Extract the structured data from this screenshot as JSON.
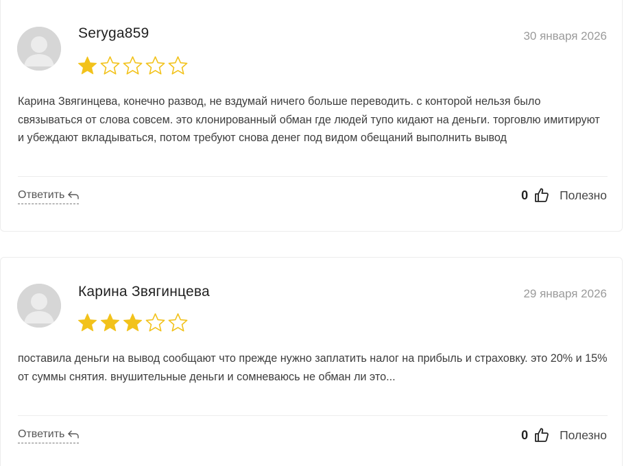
{
  "reviews": [
    {
      "author": "Seryga859",
      "date": "30 января 2026",
      "rating": 1,
      "max_rating": 5,
      "text": "Карина Звягинцева, конечно развод, не вздумай ничего больше переводить. с конторой нельзя было связываться от слова совсем. это клонированный обман где людей тупо кидают на деньги. торговлю имитируют и убеждают вкладываться, потом требуют снова денег под видом обещаний выполнить вывод",
      "reply_label": "Ответить",
      "helpful_count": "0",
      "helpful_label": "Полезно"
    },
    {
      "author": "Карина Звягинцева",
      "date": "29 января 2026",
      "rating": 3,
      "max_rating": 5,
      "text": "поставила деньги на вывод сообщают что прежде нужно заплатить налог на прибыль и страховку. это 20% и 15% от суммы снятия. внушительные деньги и сомневаюсь не обман ли это...",
      "reply_label": "Ответить",
      "helpful_count": "0",
      "helpful_label": "Полезно"
    }
  ],
  "colors": {
    "star_filled": "#f2c21b",
    "star_outline": "#f2c21b",
    "avatar_bg": "#d6d6d6",
    "avatar_fg": "#ececec"
  },
  "icons": {
    "avatar": "user-placeholder-icon",
    "star": "star-icon",
    "reply": "reply-arrow-icon",
    "like": "thumbs-up-icon"
  }
}
